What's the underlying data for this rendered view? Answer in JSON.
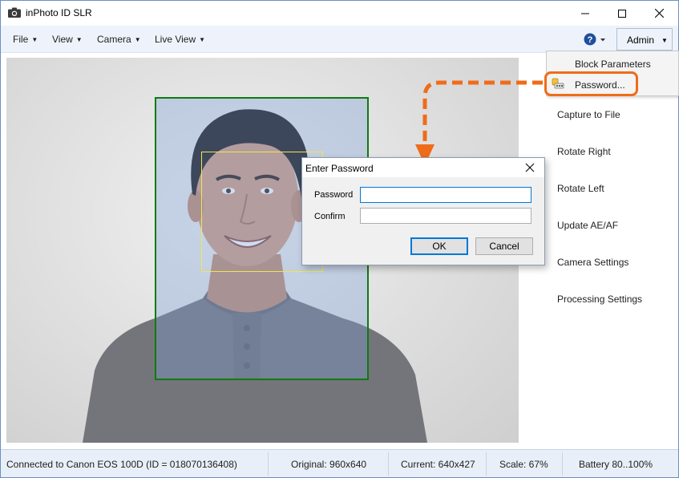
{
  "window": {
    "title": "inPhoto ID SLR"
  },
  "menu": {
    "items": [
      {
        "label": "File"
      },
      {
        "label": "View"
      },
      {
        "label": "Camera"
      },
      {
        "label": "Live View"
      }
    ],
    "admin_label": "Admin"
  },
  "admin_menu": {
    "items": [
      {
        "label": "Block Parameters"
      },
      {
        "label": "Password..."
      }
    ]
  },
  "side_panel": {
    "buttons": [
      {
        "label": "Capture to File"
      },
      {
        "label": "Rotate Right"
      },
      {
        "label": "Rotate Left"
      },
      {
        "label": "Update AE/AF"
      },
      {
        "label": "Camera Settings"
      },
      {
        "label": "Processing Settings"
      }
    ]
  },
  "dialog": {
    "title": "Enter Password",
    "password_label": "Password",
    "confirm_label": "Confirm",
    "password_value": "",
    "confirm_value": "",
    "ok_label": "OK",
    "cancel_label": "Cancel"
  },
  "status": {
    "connection": "Connected to Canon EOS 100D (ID = 018070136408)",
    "original": "Original: 960x640",
    "current": "Current: 640x427",
    "scale": "Scale: 67%",
    "battery": "Battery 80..100%"
  },
  "colors": {
    "highlight": "#ef6c1a",
    "crop_frame": "#0f7a10",
    "face_frame": "#f2e64a",
    "accent": "#0078d7"
  },
  "icons": [
    "camera-app-icon",
    "minimize-icon",
    "maximize-icon",
    "close-icon",
    "help-icon",
    "password-key-icon",
    "dialog-close-icon",
    "dashed-arrow-annotation"
  ]
}
